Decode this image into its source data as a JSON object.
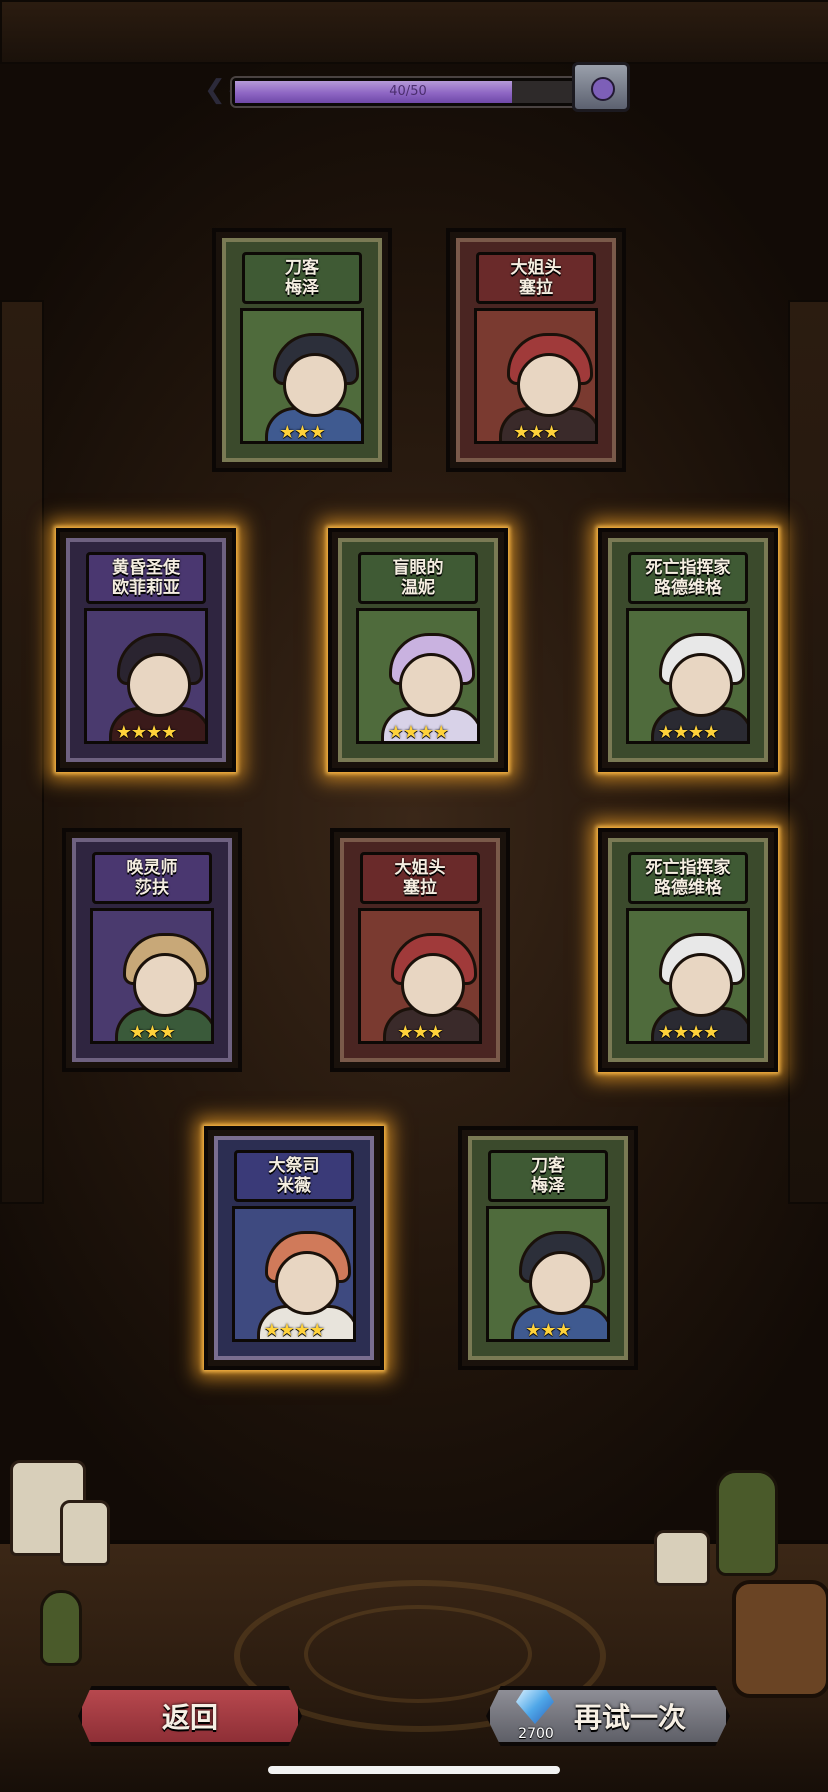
{
  "progress": {
    "current": 40,
    "max": 50,
    "text": "40/50"
  },
  "cards": [
    {
      "name_line1": "刀客",
      "name_line2": "梅泽",
      "stars": 3,
      "stars_text": "★★★",
      "theme": "green",
      "glow": false,
      "hair_color": "#2c2f3a",
      "cloth_color": "#3f5a90"
    },
    {
      "name_line1": "大姐头",
      "name_line2": "塞拉",
      "stars": 3,
      "stars_text": "★★★",
      "theme": "red",
      "glow": false,
      "hair_color": "#a03a3a",
      "cloth_color": "#3a2a2a"
    },
    {
      "name_line1": "黄昏圣使",
      "name_line2": "欧菲莉亚",
      "stars": 4,
      "stars_text": "★★★★",
      "theme": "purple",
      "glow": true,
      "hair_color": "#2a2430",
      "cloth_color": "#3a1a1a"
    },
    {
      "name_line1": "盲眼的",
      "name_line2": "温妮",
      "stars": 4,
      "stars_text": "★★★★",
      "theme": "green",
      "glow": true,
      "hair_color": "#c9b2e0",
      "cloth_color": "#d8d2e8"
    },
    {
      "name_line1": "死亡指挥家",
      "name_line2": "路德维格",
      "stars": 4,
      "stars_text": "★★★★",
      "theme": "green",
      "glow": true,
      "hair_color": "#e8e8e8",
      "cloth_color": "#2a2a32"
    },
    {
      "name_line1": "唤灵师",
      "name_line2": "莎扶",
      "stars": 3,
      "stars_text": "★★★",
      "theme": "purple",
      "glow": false,
      "hair_color": "#c8a878",
      "cloth_color": "#3a5a3a"
    },
    {
      "name_line1": "大姐头",
      "name_line2": "塞拉",
      "stars": 3,
      "stars_text": "★★★",
      "theme": "red",
      "glow": false,
      "hair_color": "#a03a3a",
      "cloth_color": "#3a2a2a"
    },
    {
      "name_line1": "死亡指挥家",
      "name_line2": "路德维格",
      "stars": 4,
      "stars_text": "★★★★",
      "theme": "green",
      "glow": true,
      "hair_color": "#e8e8e8",
      "cloth_color": "#2a2a32"
    },
    {
      "name_line1": "大祭司",
      "name_line2": "米薇",
      "stars": 4,
      "stars_text": "★★★★",
      "theme": "blue",
      "glow": true,
      "hair_color": "#d07a5a",
      "cloth_color": "#e8e4dc"
    },
    {
      "name_line1": "刀客",
      "name_line2": "梅泽",
      "stars": 3,
      "stars_text": "★★★",
      "theme": "green",
      "glow": false,
      "hair_color": "#2c2f3a",
      "cloth_color": "#3f5a90"
    }
  ],
  "buttons": {
    "back_label": "返回",
    "retry_label": "再试一次",
    "retry_cost": "2700",
    "retry_currency_icon": "diamond-icon"
  },
  "colors": {
    "progress_fill": "#8e66c4",
    "glow": "#f0a028",
    "star": "#ffd23a",
    "back_button": "#a23c43",
    "retry_button": "#7a7a82"
  }
}
